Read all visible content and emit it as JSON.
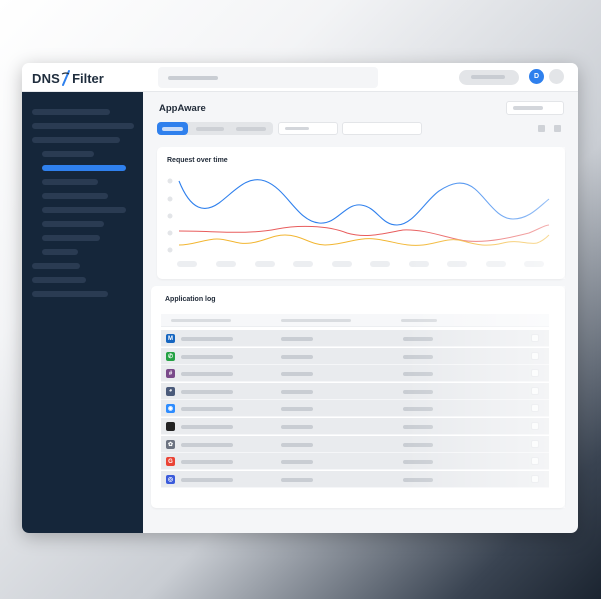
{
  "app": {
    "logo": {
      "part_a": "DNS",
      "part_b": "Filter"
    },
    "avatar_initial": "D"
  },
  "page": {
    "title": "AppAware"
  },
  "request_chart": {
    "title": "Request over time"
  },
  "colors": {
    "accent": "#2f80ed",
    "sidebar": "#15263a",
    "series_blue": "#2f80ed",
    "series_red": "#e85d5d",
    "series_yellow": "#f2b632"
  },
  "application_log": {
    "title": "Application log",
    "rows": [
      {
        "icon": "outlook-icon",
        "glyph": "M",
        "color": "#1565c0"
      },
      {
        "icon": "whatsapp-icon",
        "glyph": "✆",
        "color": "#25a244"
      },
      {
        "icon": "slack-icon",
        "glyph": "#",
        "color": "#7a4a8a"
      },
      {
        "icon": "discord-icon",
        "glyph": "◕",
        "color": "#4a5a7a"
      },
      {
        "icon": "zoom-icon",
        "glyph": "◉",
        "color": "#2d8cff"
      },
      {
        "icon": "apple-icon",
        "glyph": "",
        "color": "#222222"
      },
      {
        "icon": "chatgpt-icon",
        "glyph": "✿",
        "color": "#6b7280"
      },
      {
        "icon": "google-icon",
        "glyph": "G",
        "color": "#ea4335"
      },
      {
        "icon": "messenger-icon",
        "glyph": "◎",
        "color": "#3b5bdb"
      }
    ]
  }
}
